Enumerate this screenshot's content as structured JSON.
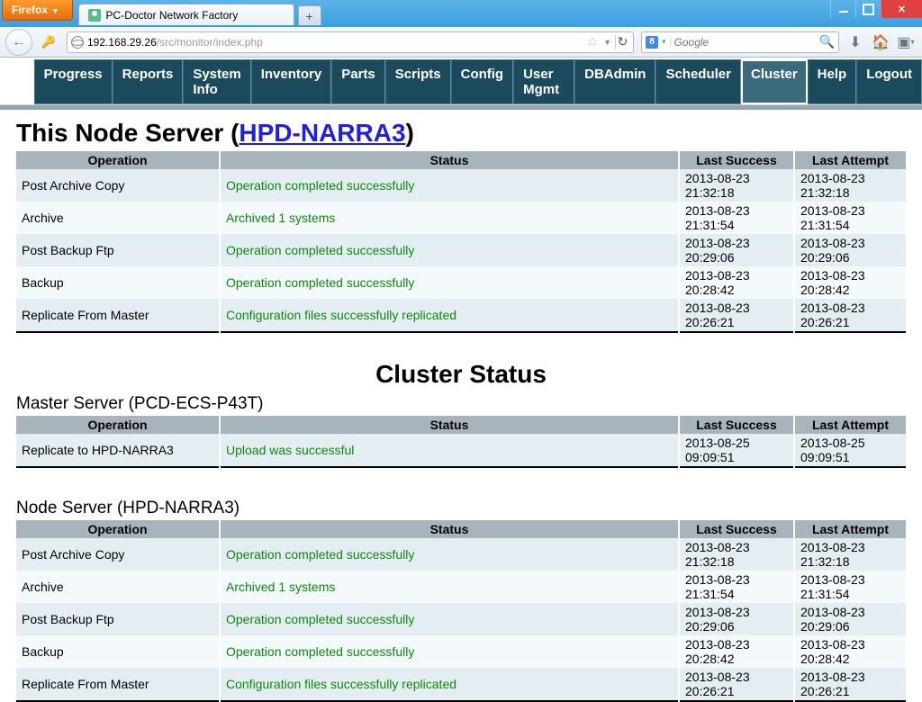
{
  "browser": {
    "name": "Firefox",
    "tab_title": "PC-Doctor Network Factory",
    "newtab": "+",
    "url_host": "192.168.29.26",
    "url_path": "/src/monitor/index.php",
    "search_placeholder": "Google",
    "search_engine_glyph": "8"
  },
  "menu": [
    "Progress",
    "Reports",
    "System Info",
    "Inventory",
    "Parts",
    "Scripts",
    "Config",
    "User Mgmt",
    "DBAdmin",
    "Scheduler",
    "Cluster",
    "Help",
    "Logout"
  ],
  "menu_active": "Cluster",
  "this_node": {
    "title_prefix": "This Node Server (",
    "title_link": "HPD-NARRA3",
    "title_suffix": ")"
  },
  "cols": {
    "operation": "Operation",
    "status": "Status",
    "last_success": "Last Success",
    "last_attempt": "Last Attempt"
  },
  "this_rows": [
    {
      "op": "Post Archive Copy",
      "st": "Operation completed successfully",
      "ls": "2013-08-23 21:32:18",
      "la": "2013-08-23 21:32:18"
    },
    {
      "op": "Archive",
      "st": "Archived 1 systems",
      "ls": "2013-08-23 21:31:54",
      "la": "2013-08-23 21:31:54"
    },
    {
      "op": "Post Backup Ftp",
      "st": "Operation completed successfully",
      "ls": "2013-08-23 20:29:06",
      "la": "2013-08-23 20:29:06"
    },
    {
      "op": "Backup",
      "st": "Operation completed successfully",
      "ls": "2013-08-23 20:28:42",
      "la": "2013-08-23 20:28:42"
    },
    {
      "op": "Replicate From Master",
      "st": "Configuration files successfully replicated",
      "ls": "2013-08-23 20:26:21",
      "la": "2013-08-23 20:26:21"
    }
  ],
  "cluster_title": "Cluster Status",
  "master_head": "Master Server (PCD-ECS-P43T)",
  "master_rows": [
    {
      "op": "Replicate to HPD-NARRA3",
      "st": "Upload was successful",
      "ls": "2013-08-25 09:09:51",
      "la": "2013-08-25 09:09:51"
    }
  ],
  "node_head": "Node Server (HPD-NARRA3)",
  "node_rows": [
    {
      "op": "Post Archive Copy",
      "st": "Operation completed successfully",
      "ls": "2013-08-23 21:32:18",
      "la": "2013-08-23 21:32:18"
    },
    {
      "op": "Archive",
      "st": "Archived 1 systems",
      "ls": "2013-08-23 21:31:54",
      "la": "2013-08-23 21:31:54"
    },
    {
      "op": "Post Backup Ftp",
      "st": "Operation completed successfully",
      "ls": "2013-08-23 20:29:06",
      "la": "2013-08-23 20:29:06"
    },
    {
      "op": "Backup",
      "st": "Operation completed successfully",
      "ls": "2013-08-23 20:28:42",
      "la": "2013-08-23 20:28:42"
    },
    {
      "op": "Replicate From Master",
      "st": "Configuration files successfully replicated",
      "ls": "2013-08-23 20:26:21",
      "la": "2013-08-23 20:26:21"
    }
  ]
}
